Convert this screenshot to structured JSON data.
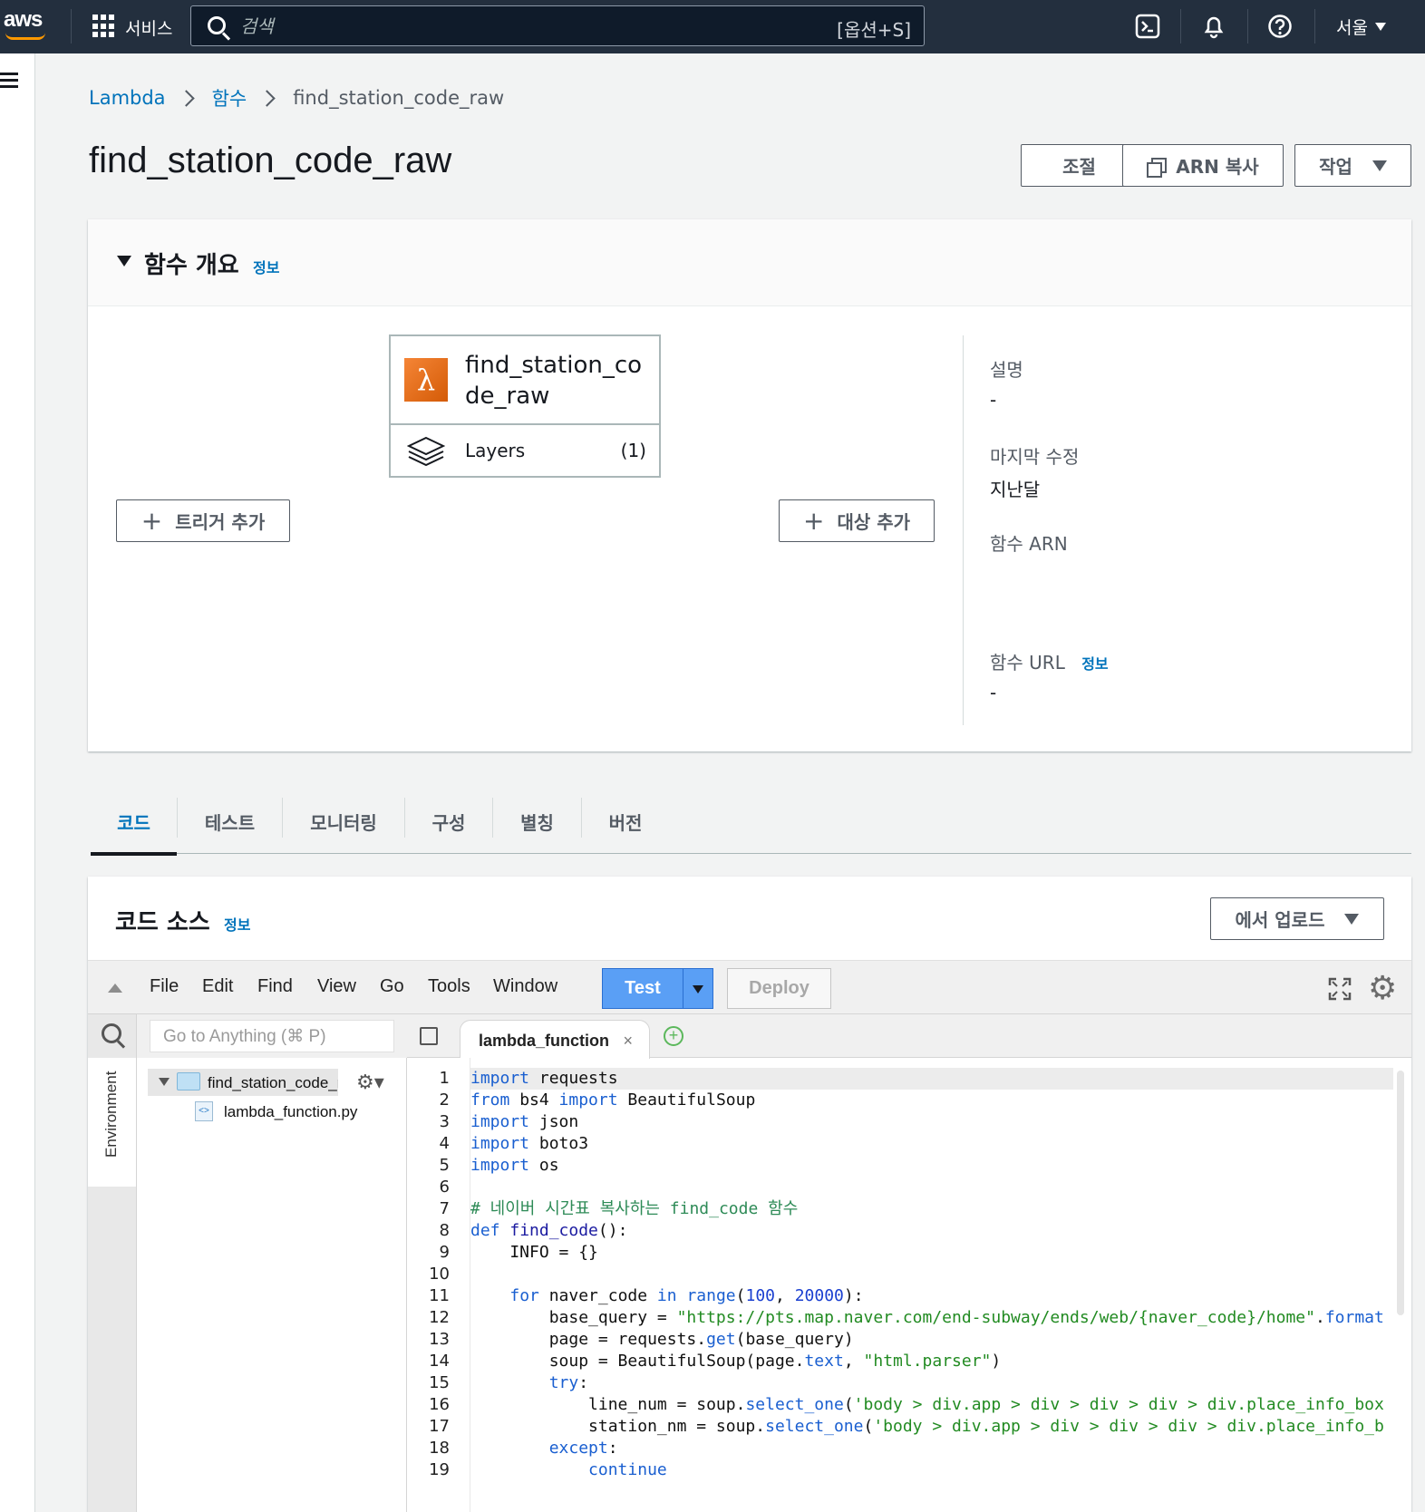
{
  "topnav": {
    "logo": "aws",
    "services_label": "서비스",
    "search_placeholder": "검색",
    "search_shortcut": "[옵션+S]",
    "region": "서울"
  },
  "breadcrumb": {
    "items": [
      "Lambda",
      "함수",
      "find_station_code_raw"
    ]
  },
  "page": {
    "title": "find_station_code_raw",
    "buttons": {
      "throttle": "조절",
      "copy_arn": "ARN 복사",
      "actions": "작업"
    }
  },
  "overview": {
    "title": "함수 개요",
    "info": "정보",
    "function_name": "find_station_code_raw",
    "layers_label": "Layers",
    "layers_count": "(1)",
    "add_trigger": "트리거 추가",
    "add_destination": "대상 추가",
    "description_label": "설명",
    "description_value": "-",
    "last_modified_label": "마지막 수정",
    "last_modified_value": "지난달",
    "arn_label": "함수 ARN",
    "url_label": "함수 URL",
    "url_info": "정보",
    "url_value": "-"
  },
  "tabs": [
    {
      "label": "코드",
      "active": true
    },
    {
      "label": "테스트"
    },
    {
      "label": "모니터링"
    },
    {
      "label": "구성"
    },
    {
      "label": "별칭"
    },
    {
      "label": "버전"
    }
  ],
  "code_source": {
    "title": "코드 소스",
    "info": "정보",
    "upload_button": "에서 업로드",
    "menu": [
      "File",
      "Edit",
      "Find",
      "View",
      "Go",
      "Tools",
      "Window"
    ],
    "test_button": "Test",
    "deploy_button": "Deploy",
    "goto_placeholder": "Go to Anything (⌘ P)",
    "environment_label": "Environment",
    "folder_name": "find_station_code_r",
    "file_name": "lambda_function.py",
    "editor_tab": "lambda_function",
    "editor_tab_close": "×",
    "add_tab": "+"
  },
  "code": {
    "line_numbers": [
      "1",
      "2",
      "3",
      "4",
      "5",
      "6",
      "7",
      "8",
      "9",
      "10",
      "11",
      "12",
      "13",
      "14",
      "15",
      "16",
      "17",
      "18",
      "19"
    ],
    "lines": [
      "import requests",
      "from bs4 import BeautifulSoup",
      "import json",
      "import boto3",
      "import os",
      "",
      "# 네이버 시간표 복사하는 find_code 함수",
      "def find_code():",
      "    INFO = {}",
      "",
      "    for naver_code in range(100, 20000):",
      "        base_query = \"https://pts.map.naver.com/end-subway/ends/web/{naver_code}/home\".format",
      "        page = requests.get(base_query)",
      "        soup = BeautifulSoup(page.text, \"html.parser\")",
      "        try:",
      "            line_num = soup.select_one('body > div.app > div > div > div > div.place_info_box",
      "            station_nm = soup.select_one('body > div.app > div > div > div > div.place_info_b",
      "        except:",
      "            continue"
    ]
  }
}
